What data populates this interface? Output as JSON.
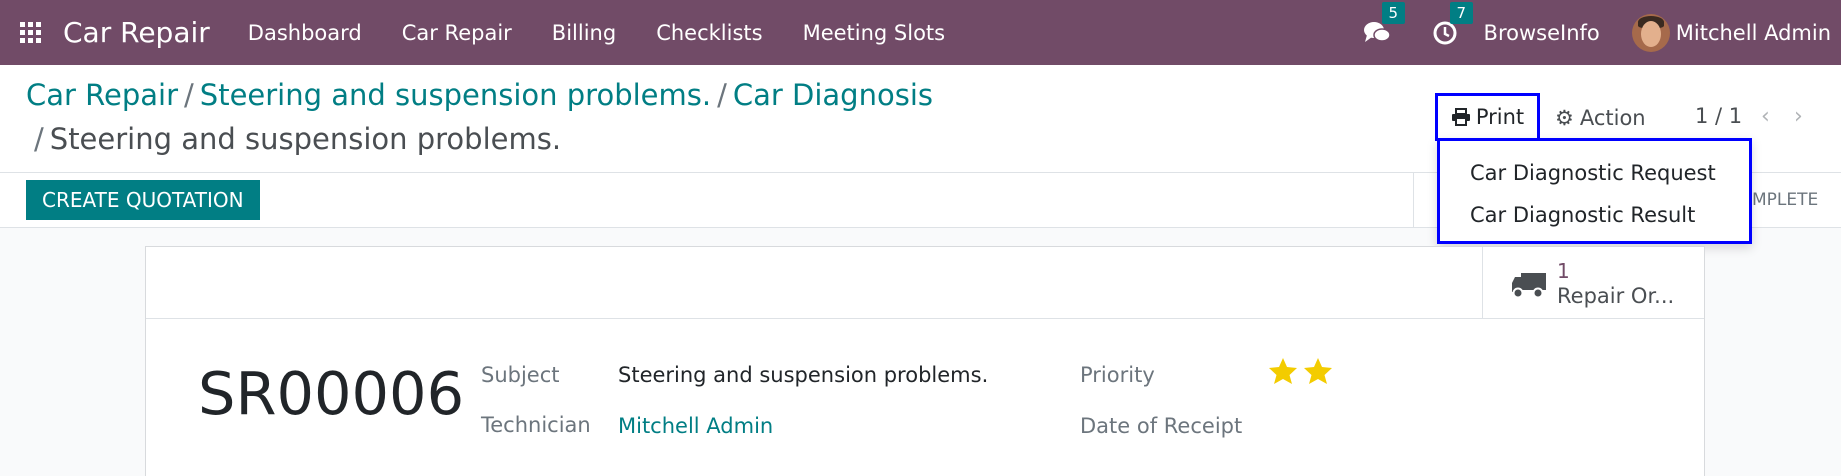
{
  "navbar": {
    "brand": "Car Repair",
    "menu": [
      "Dashboard",
      "Car Repair",
      "Billing",
      "Checklists",
      "Meeting Slots"
    ],
    "messages_count": "5",
    "activities_count": "7",
    "company": "BrowseInfo",
    "user": "Mitchell Admin"
  },
  "breadcrumb": {
    "crumbs": [
      "Car Repair",
      "Steering and suspension problems.",
      "Car Diagnosis"
    ],
    "current": "Steering and suspension problems."
  },
  "toolbar": {
    "print_label": "Print",
    "action_label": "Action",
    "pager": "1 / 1"
  },
  "print_menu": {
    "items": [
      "Car Diagnostic Request",
      "Car Diagnostic Result"
    ]
  },
  "statusbar": {
    "create_label": "CREATE QUOTATION",
    "status_partial": "MPLETE"
  },
  "smart_button": {
    "count": "1",
    "label": "Repair Or..."
  },
  "form": {
    "name": "SR00006",
    "subject_label": "Subject",
    "subject_value": "Steering and suspension problems.",
    "technician_label": "Technician",
    "technician_value": "Mitchell Admin",
    "priority_label": "Priority",
    "priority_stars": 2,
    "receipt_label": "Date of Receipt"
  },
  "colors": {
    "navbar": "#714b67",
    "accent": "#017e84",
    "highlight": "#0000ff",
    "star": "#f3cc00"
  }
}
